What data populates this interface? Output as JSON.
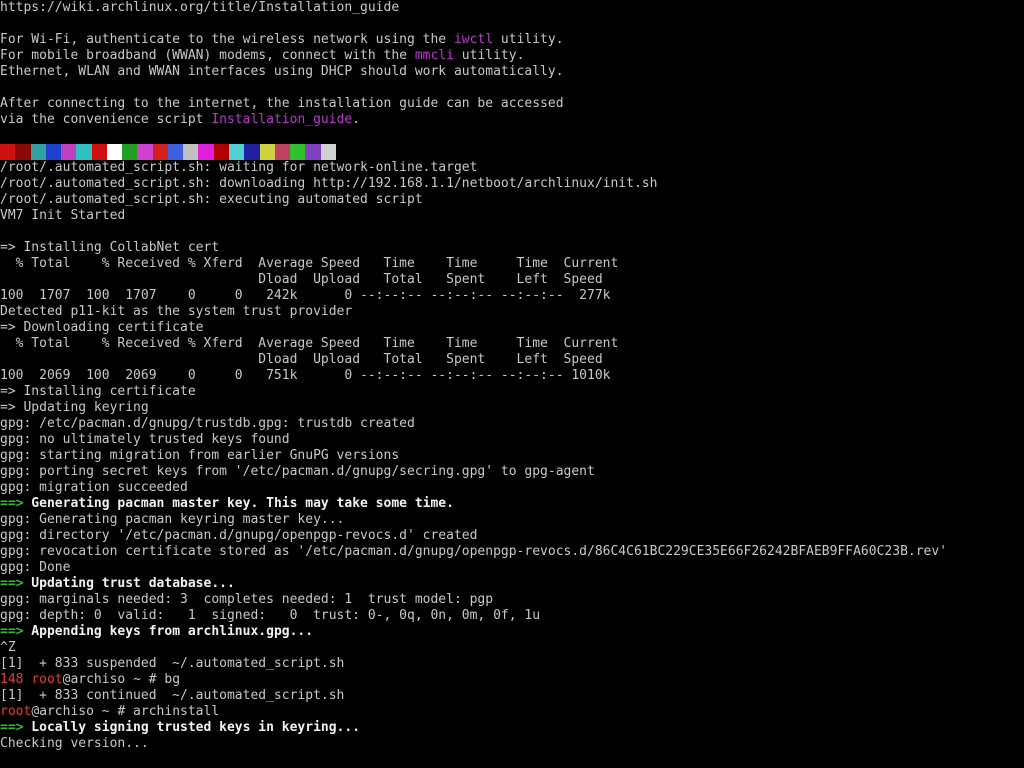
{
  "terminal": {
    "background": "#000000",
    "colors": {
      "default": "#c8c8c8",
      "bright": "#f2f2f2",
      "magenta": "#b43cc8",
      "green": "#2ec02e",
      "red": "#e03c3c"
    },
    "color_strip": [
      "#d01010",
      "#8a0a0a",
      "#30a0a0",
      "#2040d0",
      "#c040c0",
      "#30c0c0",
      "#d01010",
      "#ffffff",
      "#20a020",
      "#d040d0",
      "#d02020",
      "#4060e0",
      "#c0c0c0",
      "#e020e0",
      "#b00000",
      "#50d0d0",
      "#2020a0",
      "#d0d040",
      "#c04060",
      "#30c030",
      "#8040c0",
      "#d0d0d0"
    ],
    "lines": [
      [
        {
          "t": "https://wiki.archlinux.org/title/Installation_guide",
          "c": "plain"
        }
      ],
      [],
      [
        {
          "t": "For Wi-Fi, authenticate to the wireless network using the ",
          "c": "plain"
        },
        {
          "t": "iwctl",
          "c": "magenta"
        },
        {
          "t": " utility.",
          "c": "plain"
        }
      ],
      [
        {
          "t": "For mobile broadband (WWAN) modems, connect with the ",
          "c": "plain"
        },
        {
          "t": "mmcli",
          "c": "magenta"
        },
        {
          "t": " utility.",
          "c": "plain"
        }
      ],
      [
        {
          "t": "Ethernet, WLAN and WWAN interfaces using DHCP should work automatically.",
          "c": "plain"
        }
      ],
      [],
      [
        {
          "t": "After connecting to the internet, the installation guide can be accessed",
          "c": "plain"
        }
      ],
      [
        {
          "t": "via the convenience script ",
          "c": "plain"
        },
        {
          "t": "Installation_guide",
          "c": "magenta"
        },
        {
          "t": ".",
          "c": "plain"
        }
      ],
      [],
      [
        {
          "t": "",
          "c": "strip"
        }
      ],
      [
        {
          "t": "/root/.automated_script.sh: waiting for network-online.target",
          "c": "plain"
        }
      ],
      [
        {
          "t": "/root/.automated_script.sh: downloading http://192.168.1.1/netboot/archlinux/init.sh",
          "c": "plain"
        }
      ],
      [
        {
          "t": "/root/.automated_script.sh: executing automated script",
          "c": "plain"
        }
      ],
      [
        {
          "t": "VM7 Init Started",
          "c": "plain"
        }
      ],
      [],
      [
        {
          "t": "=> Installing CollabNet cert",
          "c": "plain"
        }
      ],
      [
        {
          "t": "  % Total    % Received % Xferd  Average Speed   Time    Time     Time  Current",
          "c": "plain"
        }
      ],
      [
        {
          "t": "                                 Dload  Upload   Total   Spent    Left  Speed",
          "c": "plain"
        }
      ],
      [
        {
          "t": "100  1707  100  1707    0     0   242k      0 --:--:-- --:--:-- --:--:--  277k",
          "c": "plain"
        }
      ],
      [
        {
          "t": "Detected p11-kit as the system trust provider",
          "c": "plain"
        }
      ],
      [
        {
          "t": "=> Downloading certificate",
          "c": "plain"
        }
      ],
      [
        {
          "t": "  % Total    % Received % Xferd  Average Speed   Time    Time     Time  Current",
          "c": "plain"
        }
      ],
      [
        {
          "t": "                                 Dload  Upload   Total   Spent    Left  Speed",
          "c": "plain"
        }
      ],
      [
        {
          "t": "100  2069  100  2069    0     0   751k      0 --:--:-- --:--:-- --:--:-- 1010k",
          "c": "plain"
        }
      ],
      [
        {
          "t": "=> Installing certificate",
          "c": "plain"
        }
      ],
      [
        {
          "t": "=> Updating keyring",
          "c": "plain"
        }
      ],
      [
        {
          "t": "gpg: /etc/pacman.d/gnupg/trustdb.gpg: trustdb created",
          "c": "plain"
        }
      ],
      [
        {
          "t": "gpg: no ultimately trusted keys found",
          "c": "plain"
        }
      ],
      [
        {
          "t": "gpg: starting migration from earlier GnuPG versions",
          "c": "plain"
        }
      ],
      [
        {
          "t": "gpg: porting secret keys from '/etc/pacman.d/gnupg/secring.gpg' to gpg-agent",
          "c": "plain"
        }
      ],
      [
        {
          "t": "gpg: migration succeeded",
          "c": "plain"
        }
      ],
      [
        {
          "t": "==>",
          "c": "green"
        },
        {
          "t": " Generating pacman master key. This may take some time.",
          "c": "bold"
        }
      ],
      [
        {
          "t": "gpg: Generating pacman keyring master key...",
          "c": "plain"
        }
      ],
      [
        {
          "t": "gpg: directory '/etc/pacman.d/gnupg/openpgp-revocs.d' created",
          "c": "plain"
        }
      ],
      [
        {
          "t": "gpg: revocation certificate stored as '/etc/pacman.d/gnupg/openpgp-revocs.d/86C4C61BC229CE35E66F26242BFAEB9FFA60C23B.rev'",
          "c": "plain"
        }
      ],
      [
        {
          "t": "gpg: Done",
          "c": "plain"
        }
      ],
      [
        {
          "t": "==>",
          "c": "green"
        },
        {
          "t": " Updating trust database...",
          "c": "bold"
        }
      ],
      [
        {
          "t": "gpg: marginals needed: 3  completes needed: 1  trust model: pgp",
          "c": "plain"
        }
      ],
      [
        {
          "t": "gpg: depth: 0  valid:   1  signed:   0  trust: 0-, 0q, 0n, 0m, 0f, 1u",
          "c": "plain"
        }
      ],
      [
        {
          "t": "==>",
          "c": "green"
        },
        {
          "t": " Appending keys from archlinux.gpg...",
          "c": "bold"
        }
      ],
      [
        {
          "t": "^Z",
          "c": "plain"
        }
      ],
      [
        {
          "t": "[1]  + 833 suspended  ~/.automated_script.sh",
          "c": "plain"
        }
      ],
      [
        {
          "t": "148 ",
          "c": "red"
        },
        {
          "t": "root",
          "c": "red"
        },
        {
          "t": "@archiso ~ # bg",
          "c": "plain"
        }
      ],
      [
        {
          "t": "[1]  + 833 continued  ~/.automated_script.sh",
          "c": "plain"
        }
      ],
      [
        {
          "t": "root",
          "c": "red"
        },
        {
          "t": "@archiso ~ # archinstall",
          "c": "plain"
        }
      ],
      [
        {
          "t": "==>",
          "c": "green"
        },
        {
          "t": " Locally signing trusted keys in keyring...",
          "c": "bold"
        }
      ],
      [
        {
          "t": "Checking version...",
          "c": "plain"
        }
      ]
    ]
  }
}
